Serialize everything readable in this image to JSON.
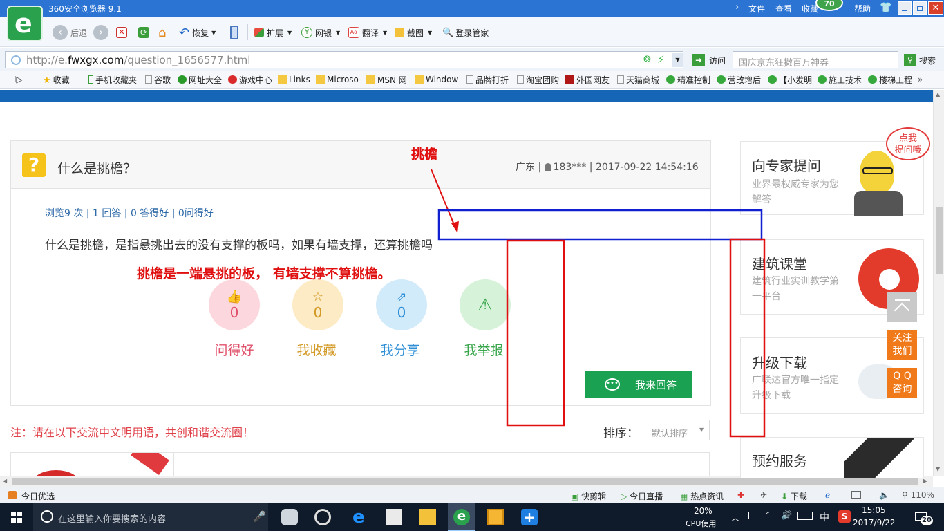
{
  "browser": {
    "title": "360安全浏览器 9.1",
    "menu": [
      "文件",
      "查看",
      "收藏",
      "帮助"
    ],
    "badge": "70",
    "toolbar": {
      "back": "后退",
      "restore": "恢复",
      "extend": "扩展",
      "netbank": "网银",
      "translate": "翻译",
      "screenshot": "截图",
      "login": "登录管家"
    },
    "url_prefix": "http://e.",
    "url_domain": "fwxgx.com",
    "url_path": "/question_1656577.html",
    "visit": "访问",
    "search_placeholder": "国庆京东狂撒百万神券",
    "search_button": "搜索",
    "bookmarks": [
      "收藏",
      "手机收藏夹",
      "谷歌",
      "网址大全",
      "游戏中心",
      "Links",
      "Microso",
      "MSN 网",
      "Window",
      "品牌打折",
      "淘宝团购",
      "外国网友",
      "天猫商城",
      "精准控制",
      "营改增后",
      "【小发明",
      "施工技术",
      "楼梯工程"
    ]
  },
  "question": {
    "title": "什么是挑檐？",
    "meta": "广东 | ",
    "user": "183*** | 2017-09-22 14:54:16",
    "stats": "浏览9 次 | 1 回答 | 0 答得好 | 0问得好",
    "body": "什么是挑檐，是指悬挑出去的没有支撑的板吗，如果有墙支撑，还算挑檐吗",
    "actions": [
      {
        "label": "问得好",
        "count": "0",
        "color": "#e0506a",
        "bg": "#fcd7dd"
      },
      {
        "label": "我收藏",
        "count": "0",
        "color": "#d39a26",
        "bg": "#fcebc4"
      },
      {
        "label": "我分享",
        "count": "0",
        "color": "#2f8fd6",
        "bg": "#d2ebfb"
      },
      {
        "label": "我举报",
        "count": "",
        "color": "#3aa64c",
        "bg": "#d6f2d9"
      }
    ],
    "answer_button": "我来回答",
    "note": "注：请在以下交流中文明用语，共创和谐交流圈！",
    "sort_label": "排序：",
    "sort_value": "默认排序"
  },
  "annotations": {
    "label_top": "挑檐",
    "label_answer": "挑檐是一端悬挑的板， 有墙支撑不算挑檐。"
  },
  "sidebar": {
    "bubble": "点我\n提问哦",
    "cards": [
      {
        "title": "向专家提问",
        "sub": "业界最权威专家为您解答"
      },
      {
        "title": "建筑课堂",
        "sub": "建筑行业实训教学第一平台"
      },
      {
        "title": "升级下载",
        "sub": "广联达官方唯一指定升级下载"
      },
      {
        "title": "预约服务",
        "sub": ""
      }
    ],
    "float_follow": "关注我们",
    "float_qq": "Q Q 咨询"
  },
  "statusbar": {
    "left": "今日优选",
    "items": [
      "快剪辑",
      "今日直播",
      "热点资讯",
      "下载"
    ],
    "zoom": "110%"
  },
  "taskbar": {
    "search": "在这里输入你要搜索的内容",
    "cpu_pct": "20%",
    "cpu_label": "CPU使用",
    "ime": "中",
    "time": "15:05",
    "date": "2017/9/22",
    "notif": "20"
  },
  "colors": {
    "browser_green": "#2aa14c",
    "answer_green": "#1aa152",
    "annotation_red": "#e01010",
    "annotation_blue": "#1020d0",
    "orange": "#f07a1a"
  }
}
